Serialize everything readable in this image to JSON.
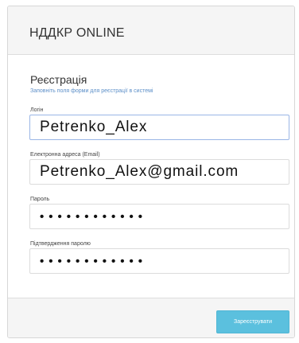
{
  "header": {
    "title": "НДДКР ONLINE"
  },
  "form": {
    "title": "Реєстрація",
    "subtitle": "Заповніть поля форми для реєстрації в системі",
    "login": {
      "label": "Логін",
      "value": "Petrenko_Alex"
    },
    "email": {
      "label": "Електронна адреса (Email)",
      "value": "Petrenko_Alex@gmail.com"
    },
    "password": {
      "label": "Пароль",
      "value": "••••••••••••"
    },
    "password_confirm": {
      "label": "Підтвердження паролю",
      "value": "••••••••••••"
    }
  },
  "footer": {
    "submit_label": "Зареєструвати"
  },
  "colors": {
    "accent": "#5bc0de",
    "subtitle": "#5c8fc8",
    "header_bg": "#f5f5f5",
    "focus_border": "#9ab6e6"
  }
}
